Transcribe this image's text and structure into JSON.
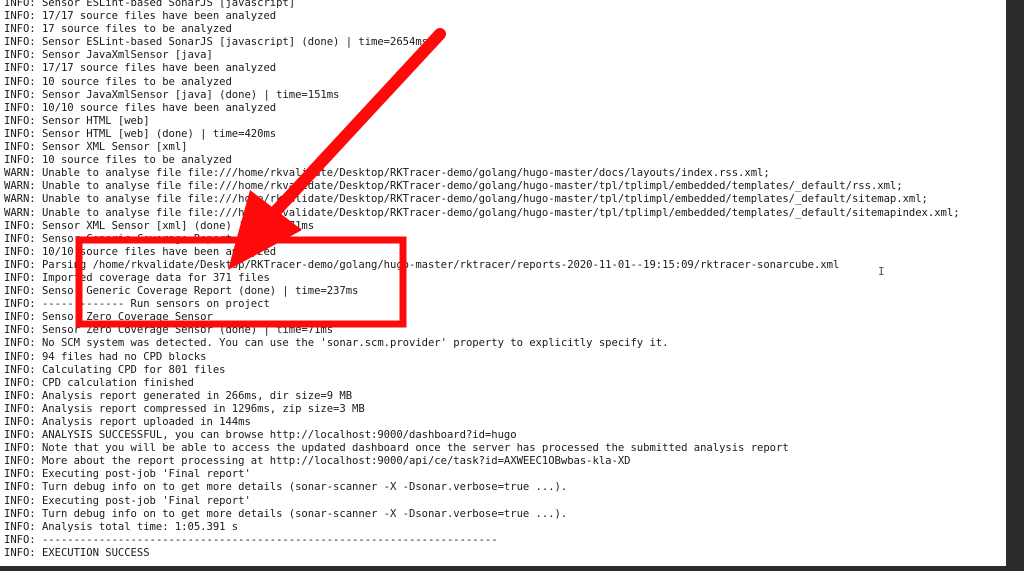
{
  "terminal": {
    "lines": [
      "INFO: Sensor ESLint-based SonarJS [javascript]",
      "INFO: 17/17 source files have been analyzed",
      "INFO: 17 source files to be analyzed",
      "INFO: Sensor ESLint-based SonarJS [javascript] (done) | time=2654ms",
      "INFO: Sensor JavaXmlSensor [java]",
      "INFO: 17/17 source files have been analyzed",
      "INFO: 10 source files to be analyzed",
      "INFO: Sensor JavaXmlSensor [java] (done) | time=151ms",
      "INFO: 10/10 source files have been analyzed",
      "INFO: Sensor HTML [web]",
      "INFO: Sensor HTML [web] (done) | time=420ms",
      "INFO: Sensor XML Sensor [xml]",
      "INFO: 10 source files to be analyzed",
      "WARN: Unable to analyse file file:///home/rkvalidate/Desktop/RKTracer-demo/golang/hugo-master/docs/layouts/index.rss.xml;",
      "WARN: Unable to analyse file file:///home/rkvalidate/Desktop/RKTracer-demo/golang/hugo-master/tpl/tplimpl/embedded/templates/_default/rss.xml;",
      "WARN: Unable to analyse file file:///home/rkvalidate/Desktop/RKTracer-demo/golang/hugo-master/tpl/tplimpl/embedded/templates/_default/sitemap.xml;",
      "WARN: Unable to analyse file file:///home/rkvalidate/Desktop/RKTracer-demo/golang/hugo-master/tpl/tplimpl/embedded/templates/_default/sitemapindex.xml;",
      "INFO: Sensor XML Sensor [xml] (done) | time=171ms",
      "INFO: Sensor Generic Coverage Report",
      "INFO: 10/10 source files have been analyzed",
      "INFO: Parsing /home/rkvalidate/Desktop/RKTracer-demo/golang/hugo-master/rktracer/reports-2020-11-01--19:15:09/rktracer-sonarcube.xml",
      "INFO: Imported coverage data for 371 files",
      "INFO: Sensor Generic Coverage Report (done) | time=237ms",
      "INFO: ------------- Run sensors on project",
      "INFO: Sensor Zero Coverage Sensor",
      "INFO: Sensor Zero Coverage Sensor (done) | time=71ms",
      "INFO: No SCM system was detected. You can use the 'sonar.scm.provider' property to explicitly specify it.",
      "INFO: 94 files had no CPD blocks",
      "INFO: Calculating CPD for 801 files",
      "INFO: CPD calculation finished",
      "INFO: Analysis report generated in 266ms, dir size=9 MB",
      "INFO: Analysis report compressed in 1296ms, zip size=3 MB",
      "INFO: Analysis report uploaded in 144ms",
      "INFO: ANALYSIS SUCCESSFUL, you can browse http://localhost:9000/dashboard?id=hugo",
      "INFO: Note that you will be able to access the updated dashboard once the server has processed the submitted analysis report",
      "INFO: More about the report processing at http://localhost:9000/api/ce/task?id=AXWEEC1OBwbas-kla-XD",
      "INFO: Executing post-job 'Final report'",
      "INFO: Turn debug info on to get more details (sonar-scanner -X -Dsonar.verbose=true ...).",
      "INFO: Executing post-job 'Final report'",
      "INFO: Turn debug info on to get more details (sonar-scanner -X -Dsonar.verbose=true ...).",
      "INFO: Analysis total time: 1:05.391 s",
      "INFO: ------------------------------------------------------------------------",
      "INFO: EXECUTION SUCCESS"
    ]
  },
  "annotation": {
    "color": "#ff0a0a",
    "arrow_icon": "arrow-down-left-icon",
    "box_icon": "highlight-box"
  },
  "cursor_glyph": "I"
}
